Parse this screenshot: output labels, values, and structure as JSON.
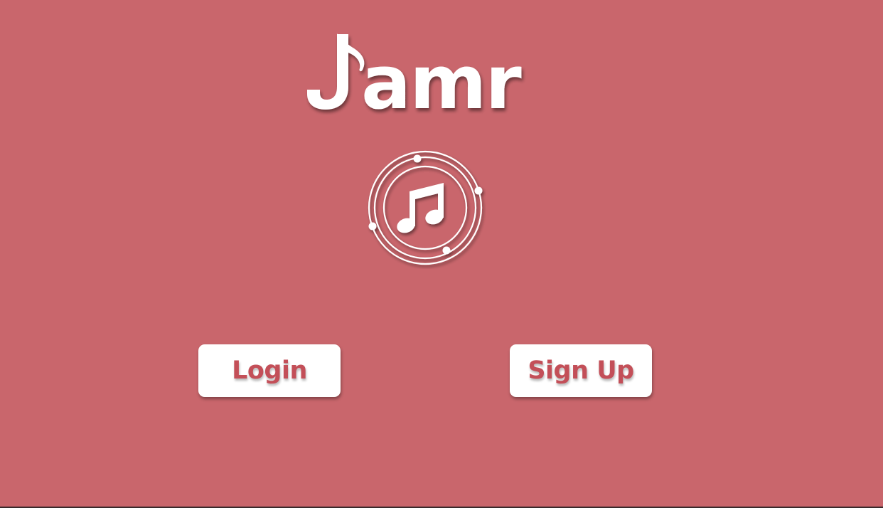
{
  "app": {
    "logo_text_rest": "amr",
    "logo_icon": "music-note-j-icon",
    "center_icon": "music-notes-orbit-icon"
  },
  "actions": {
    "login_label": "Login",
    "signup_label": "Sign Up"
  },
  "colors": {
    "background": "#c9666c",
    "button_bg": "#ffffff",
    "button_text": "#c34f58",
    "logo": "#ffffff"
  }
}
